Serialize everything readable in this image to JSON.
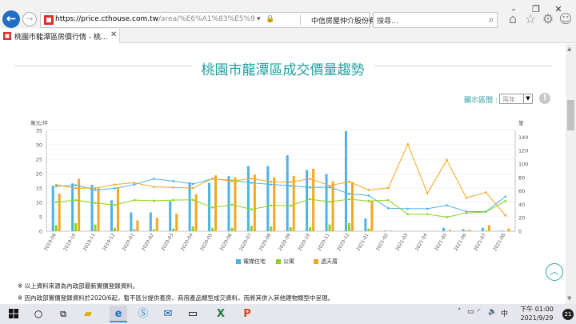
{
  "browser": {
    "url_host": "https://price.cthouse.com.tw",
    "url_path": "/area/%E6%A1%83%E5%9C%92%E5%",
    "site_cert": "中信房屋仲介股份有限公司 [...",
    "search_placeholder": "搜尋...",
    "tab_title": "桃園市龍潭區房價行情 - 桃...",
    "icons": [
      "home-icon",
      "star-icon",
      "gear-icon",
      "smiley-icon"
    ]
  },
  "page": {
    "title": "桃園市龍潭區成交價量趨勢",
    "period_label": "顯示區間 :",
    "period_value": "兩年",
    "info_symbol": "!",
    "notes": [
      "※ 以上資料來源為內政部最新實價登錄資料。",
      "※ 因內政部實價登錄資料於2020/6起，暫不區分提供套房、商用產品類型成交資料，而將其併入其他建物類型中呈現。"
    ]
  },
  "chart_data": {
    "type": "bar",
    "title": "",
    "ylabel_left": "萬元/坪",
    "ylabel_right": "筆",
    "ylim_left": [
      0,
      35
    ],
    "ylim_right": [
      0,
      150
    ],
    "yticks_left": [
      0,
      5,
      10,
      15,
      20,
      25,
      30,
      35
    ],
    "yticks_right": [
      0,
      20,
      40,
      60,
      80,
      100,
      120,
      140
    ],
    "categories": [
      "2019-09",
      "2019-10",
      "2019-11",
      "2019-12",
      "2020-01",
      "2020-02",
      "2020-03",
      "2020-04",
      "2020-05",
      "2020-06",
      "2020-07",
      "2020-08",
      "2020-09",
      "2020-10",
      "2020-11",
      "2020-12",
      "2021-01",
      "2021-02",
      "2021-03",
      "2021-04",
      "2021-05",
      "2021-06",
      "2021-07",
      "2021-08"
    ],
    "bar_series": [
      {
        "name": "電梯住宅",
        "color": "#4bb3e6",
        "axis": "right",
        "values": [
          68,
          71,
          69,
          46,
          28,
          28,
          45,
          73,
          72,
          82,
          97,
          97,
          113,
          91,
          85,
          149,
          19,
          1,
          0,
          0,
          5,
          3,
          5,
          1
        ]
      },
      {
        "name": "公寓",
        "color": "#8bd31c",
        "axis": "right",
        "values": [
          9,
          12,
          10,
          5,
          3,
          3,
          4,
          7,
          5,
          5,
          8,
          7,
          6,
          6,
          10,
          12,
          4,
          0,
          0,
          0,
          0,
          1,
          1,
          0
        ]
      },
      {
        "name": "透天厝",
        "color": "#f5a623",
        "axis": "right",
        "values": [
          56,
          78,
          64,
          64,
          16,
          20,
          26,
          55,
          83,
          80,
          84,
          80,
          82,
          93,
          74,
          73,
          45,
          1,
          0,
          0,
          2,
          2,
          9,
          4
        ]
      }
    ],
    "line_series": [
      {
        "name": "電梯住宅",
        "color": "#4bb3e6",
        "axis": "left",
        "values": [
          15.6,
          16,
          14.3,
          14.9,
          16.2,
          18.2,
          17.4,
          16.4,
          18.2,
          17.6,
          16.8,
          16.2,
          15.8,
          15.2,
          15.3,
          13,
          12.4,
          8,
          7.8,
          7.8,
          9,
          6.8,
          6.8,
          12
        ]
      },
      {
        "name": "公寓",
        "color": "#8bd31c",
        "axis": "left",
        "values": [
          10.1,
          10.8,
          9.8,
          9.1,
          10.8,
          10.6,
          10.8,
          10.9,
          8.2,
          9.2,
          7.6,
          8.9,
          8.9,
          11.1,
          10.2,
          11.1,
          10.5,
          10.8,
          5.9,
          5.9,
          4.9,
          6.3,
          6.7,
          10.5
        ]
      },
      {
        "name": "透天厝",
        "color": "#f5a623",
        "axis": "left",
        "values": [
          16.1,
          14.9,
          15,
          16.2,
          16.8,
          15.4,
          15.2,
          15,
          18.3,
          17.4,
          18.3,
          17.2,
          17.1,
          18.2,
          15.8,
          17.2,
          14.3,
          15,
          30.2,
          13.2,
          24.7,
          11.6,
          13.5,
          5.5
        ]
      }
    ],
    "legend": [
      "電梯住宅",
      "公寓",
      "透天厝"
    ],
    "legend_position": "bottom",
    "grid": true
  },
  "taskbar": {
    "clock_time": "下午 01:00",
    "clock_date": "2021/9/29",
    "notification_count": "21",
    "lang": "中",
    "apps": [
      "ie-icon",
      "file-explorer-icon",
      "skype-icon",
      "outlook-icon",
      "excel-icon",
      "powerpoint-icon"
    ]
  },
  "colors": {
    "accent": "#20a0a0",
    "ie_blue": "#1f6fc5"
  }
}
